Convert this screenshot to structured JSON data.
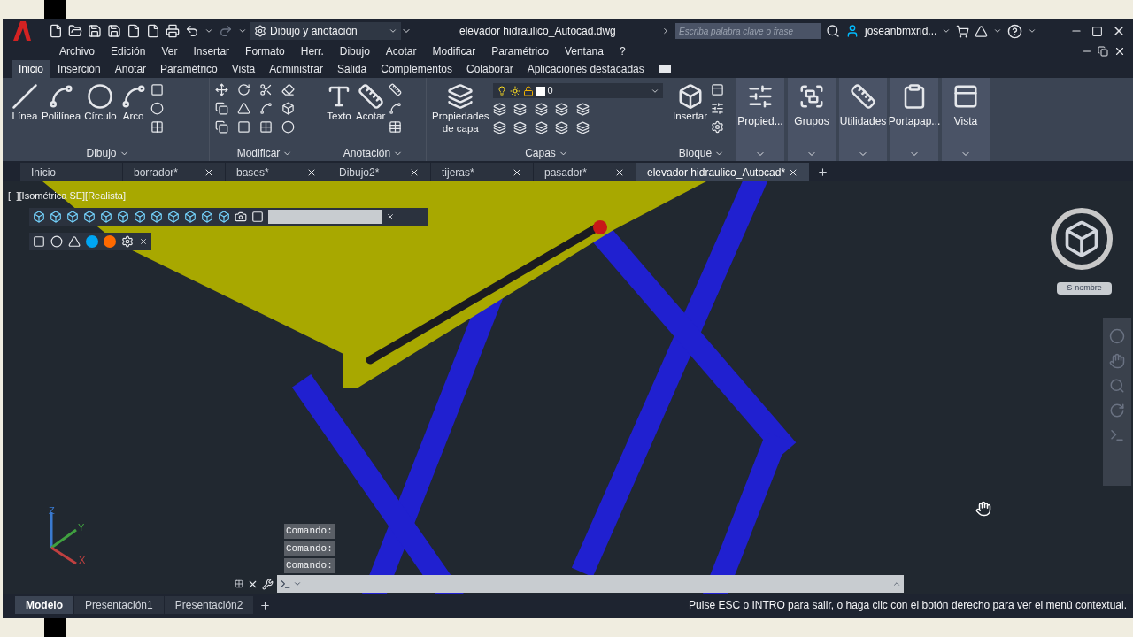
{
  "title_bar": {
    "workspace": "Dibujo y anotación",
    "title": "elevador hidraulico_Autocad.dwg",
    "search": {
      "placeholder": "Escriba palabra clave o frase"
    },
    "user": "joseanbmxrid..."
  },
  "menu_bar": [
    "Archivo",
    "Edición",
    "Ver",
    "Insertar",
    "Formato",
    "Herr.",
    "Dibujo",
    "Acotar",
    "Modificar",
    "Paramétrico",
    "Ventana",
    "?"
  ],
  "ribbon_tabs": [
    {
      "label": "Inicio",
      "selected": true
    },
    {
      "label": "Inserción",
      "selected": false
    },
    {
      "label": "Anotar",
      "selected": false
    },
    {
      "label": "Paramétrico",
      "selected": false
    },
    {
      "label": "Vista",
      "selected": false
    },
    {
      "label": "Administrar",
      "selected": false
    },
    {
      "label": "Salida",
      "selected": false
    },
    {
      "label": "Complementos",
      "selected": false
    },
    {
      "label": "Colaborar",
      "selected": false
    },
    {
      "label": "Aplicaciones destacadas",
      "selected": false
    }
  ],
  "ribbon_panels": [
    {
      "kind": "expanded",
      "title": "Dibujo",
      "tools": [
        "Línea",
        "Polilínea",
        "Círculo",
        "Arco"
      ]
    },
    {
      "kind": "expanded",
      "title": "Modificar"
    },
    {
      "kind": "expanded",
      "title": "Anotación",
      "tools": [
        "Texto",
        "Acotar"
      ]
    },
    {
      "kind": "expanded",
      "title": "Capas",
      "tools": [
        "Propiedades de capa"
      ],
      "layer": "0"
    },
    {
      "kind": "expanded",
      "title": "Bloque",
      "tools": [
        "Insertar"
      ]
    },
    {
      "kind": "collapsed",
      "title": "Propied..."
    },
    {
      "kind": "collapsed",
      "title": "Grupos"
    },
    {
      "kind": "collapsed",
      "title": "Utilidades"
    },
    {
      "kind": "collapsed",
      "title": "Portapap..."
    },
    {
      "kind": "collapsed",
      "title": "Vista"
    }
  ],
  "file_tabs": [
    {
      "label": "Inicio",
      "selected": false,
      "closable": false
    },
    {
      "label": "borrador*",
      "selected": false,
      "closable": true
    },
    {
      "label": "bases*",
      "selected": false,
      "closable": true
    },
    {
      "label": "Dibujo2*",
      "selected": false,
      "closable": true
    },
    {
      "label": "tijeras*",
      "selected": false,
      "closable": true
    },
    {
      "label": "pasador*",
      "selected": false,
      "closable": true
    },
    {
      "label": "elevador hidraulico_Autocad*",
      "selected": true,
      "closable": true
    }
  ],
  "viewport": {
    "label": "[−][Isométrica SE][Realista]",
    "view_cube_label": "S-nombre",
    "ucs": {
      "z": "Z",
      "y": "Y",
      "x": "X"
    }
  },
  "command_history": [
    "Comando:",
    "Comando:",
    "Comando:"
  ],
  "layout_tabs": [
    {
      "label": "Modelo",
      "selected": true
    },
    {
      "label": "Presentación1",
      "selected": false
    },
    {
      "label": "Presentación2",
      "selected": false
    }
  ],
  "status_text": "Pulse ESC o INTRO para salir, o haga clic con el botón derecho para ver el menú contextual."
}
